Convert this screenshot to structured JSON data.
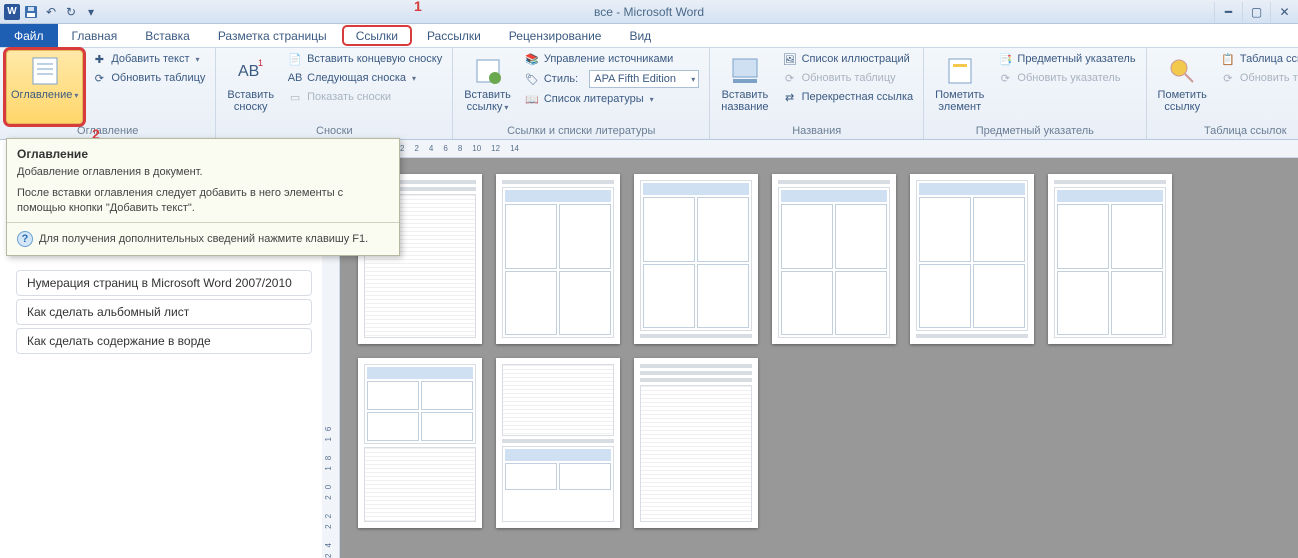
{
  "title": "все - Microsoft Word",
  "qat": {
    "word": "W"
  },
  "tabs": {
    "file": "Файл",
    "home": "Главная",
    "insert": "Вставка",
    "layout": "Разметка страницы",
    "references": "Ссылки",
    "mailings": "Рассылки",
    "review": "Рецензирование",
    "view": "Вид"
  },
  "annotations": {
    "one": "1",
    "two": "2"
  },
  "ribbon": {
    "toc": {
      "label": "Оглавление",
      "big": "Оглавление",
      "add_text": "Добавить текст",
      "update": "Обновить таблицу"
    },
    "footnotes": {
      "label": "Сноски",
      "big": "Вставить сноску",
      "end": "Вставить концевую сноску",
      "next": "Следующая сноска",
      "show": "Показать сноски"
    },
    "citations": {
      "label": "Ссылки и списки литературы",
      "big": "Вставить ссылку",
      "manage": "Управление источниками",
      "style_lbl": "Стиль:",
      "style_val": "APA Fifth Edition",
      "biblio": "Список литературы"
    },
    "captions": {
      "label": "Названия",
      "big": "Вставить название",
      "list": "Список иллюстраций",
      "update": "Обновить таблицу",
      "xref": "Перекрестная ссылка"
    },
    "index": {
      "label": "Предметный указатель",
      "big": "Пометить элемент",
      "insert": "Предметный указатель",
      "update": "Обновить указатель"
    },
    "toa": {
      "label": "Таблица ссылок",
      "big": "Пометить ссылку",
      "insert": "Таблица ссылок",
      "update": "Обновить таблицу"
    }
  },
  "tooltip": {
    "title": "Оглавление",
    "p1": "Добавление оглавления в документ.",
    "p2": "После вставки оглавления следует добавить в него элементы с помощью кнопки \"Добавить текст\".",
    "help": "Для получения дополнительных сведений нажмите клавишу F1."
  },
  "side_links": [
    "Нумерация страниц в Microsoft Word  2007/2010",
    "Как сделать альбомный лист",
    "Как сделать содержание в ворде"
  ],
  "ruler_h": [
    "2",
    "2",
    "4",
    "6",
    "8",
    "10",
    "12",
    "14"
  ],
  "ruler_v": "24 22 20 18 16"
}
